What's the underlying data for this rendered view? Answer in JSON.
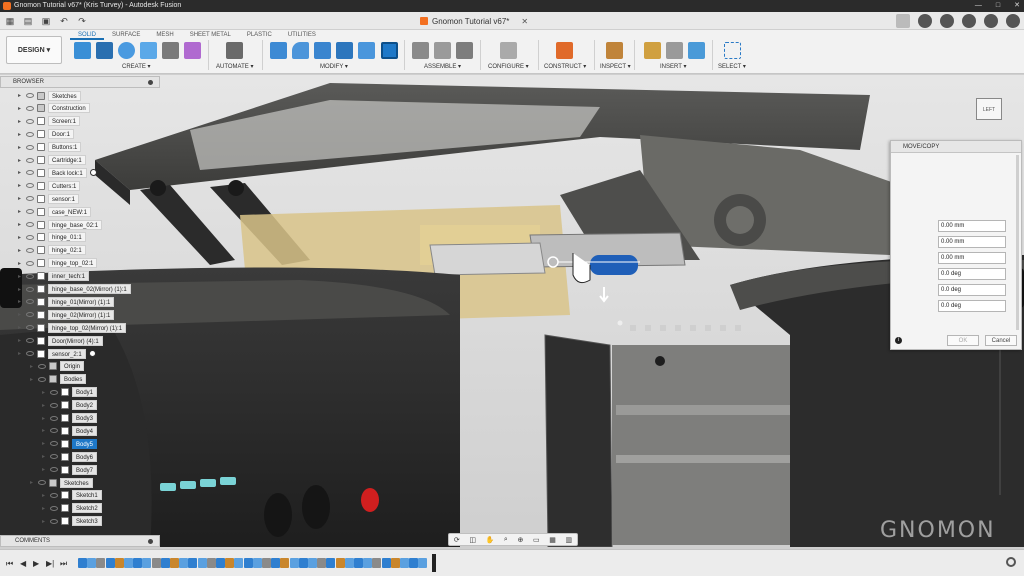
{
  "window": {
    "title": "Gnomon Tutorial v67* (Kris Turvey) - Autodesk Fusion",
    "controls": [
      "—",
      "□",
      "✕"
    ]
  },
  "document": {
    "tab_title": "Gnomon Tutorial v67*",
    "close_glyph": "✕"
  },
  "ribbon": {
    "workspace": "DESIGN ▾",
    "tabs": [
      "SOLID",
      "SURFACE",
      "MESH",
      "SHEET METAL",
      "PLASTIC",
      "UTILITIES"
    ],
    "active_tab": "SOLID",
    "groups": [
      "CREATE ▾",
      "AUTOMATE ▾",
      "MODIFY ▾",
      "ASSEMBLE ▾",
      "CONFIGURE ▾",
      "CONSTRUCT ▾",
      "INSPECT ▾",
      "INSERT ▾",
      "SELECT ▾"
    ]
  },
  "browser": {
    "title": "BROWSER",
    "items": [
      {
        "label": "Sketches",
        "depth": 0,
        "folder": true
      },
      {
        "label": "Construction",
        "depth": 0,
        "folder": true
      },
      {
        "label": "Screen:1",
        "depth": 0
      },
      {
        "label": "Door:1",
        "depth": 0
      },
      {
        "label": "Buttons:1",
        "depth": 0
      },
      {
        "label": "Cartridge:1",
        "depth": 0
      },
      {
        "label": "Back lock:1",
        "depth": 0,
        "mark": true
      },
      {
        "label": "Cutters:1",
        "depth": 0
      },
      {
        "label": "sensor:1",
        "depth": 0
      },
      {
        "label": "case_NEW:1",
        "depth": 0
      },
      {
        "label": "hinge_base_02:1",
        "depth": 0
      },
      {
        "label": "hinge_01:1",
        "depth": 0
      },
      {
        "label": "hinge_02:1",
        "depth": 0
      },
      {
        "label": "hinge_top_02:1",
        "depth": 0
      },
      {
        "label": "inner_tech:1",
        "depth": 0
      },
      {
        "label": "hinge_base_02(Mirror) (1):1",
        "depth": 0
      },
      {
        "label": "hinge_01(Mirror) (1):1",
        "depth": 0
      },
      {
        "label": "hinge_02(Mirror) (1):1",
        "depth": 0
      },
      {
        "label": "hinge_top_02(Mirror) (1):1",
        "depth": 0
      },
      {
        "label": "Door(Mirror) (4):1",
        "depth": 0
      },
      {
        "label": "sensor_2:1",
        "depth": 0,
        "mark": true
      },
      {
        "label": "Origin",
        "depth": 1,
        "folder": true
      },
      {
        "label": "Bodies",
        "depth": 1,
        "folder": true
      },
      {
        "label": "Body1",
        "depth": 2
      },
      {
        "label": "Body2",
        "depth": 2
      },
      {
        "label": "Body3",
        "depth": 2
      },
      {
        "label": "Body4",
        "depth": 2
      },
      {
        "label": "Body5",
        "depth": 2,
        "selected": true
      },
      {
        "label": "Body6",
        "depth": 2
      },
      {
        "label": "Body7",
        "depth": 2
      },
      {
        "label": "Sketches",
        "depth": 1,
        "folder": true
      },
      {
        "label": "Sketch1",
        "depth": 2
      },
      {
        "label": "Sketch2",
        "depth": 2
      },
      {
        "label": "Sketch3",
        "depth": 2
      }
    ]
  },
  "comments": {
    "title": "COMMENTS"
  },
  "dialog": {
    "title": "MOVE/COPY",
    "fields": [
      "0.00 mm",
      "0.00 mm",
      "0.00 mm",
      "0.0 deg",
      "0.0 deg",
      "0.0 deg"
    ],
    "ok_label": "OK",
    "cancel_label": "Cancel"
  },
  "viewcube": {
    "face_label": "LEFT"
  },
  "watermark": "GNOMON",
  "colors": {
    "accent": "#1e78c8",
    "brand": "#f37021"
  }
}
